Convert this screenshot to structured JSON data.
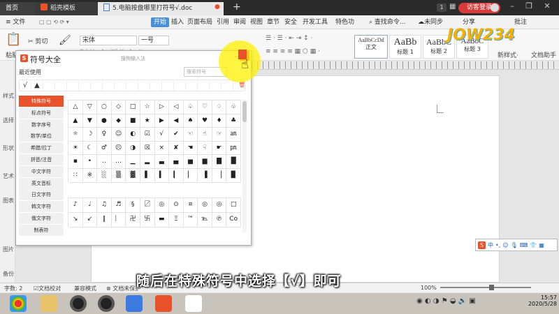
{
  "titlebar": {
    "home_tab": "首页",
    "template_tab": "稻壳模板",
    "doc_tab": "5.电脑按盘哪里打符号√.doc",
    "badge": "1",
    "login": "访客登录"
  },
  "menubar": {
    "file": "≡ 文件",
    "items": [
      "开始",
      "插入",
      "页面布局",
      "引用",
      "审阅",
      "视图",
      "章节",
      "安全",
      "开发工具",
      "特色功"
    ],
    "search": "查找命令...",
    "sync": "未同步",
    "share": "分享",
    "comment": "批注"
  },
  "ribbon": {
    "paste": "粘贴",
    "cut": "剪切",
    "format_painter": "格式刷",
    "font_name": "宋体",
    "font_size": "一号",
    "styles": [
      {
        "sample": "AaBbCcDd",
        "name": "正文"
      },
      {
        "sample": "AaBb",
        "name": "标题 1"
      },
      {
        "sample": "AaBbC",
        "name": "标题 2"
      },
      {
        "sample": "AaBbC",
        "name": "标题 3"
      }
    ],
    "new_style": "新样式·",
    "doc_helper": "文档助手"
  },
  "left_tools": [
    "样式",
    "选择",
    "形状",
    "艺术",
    "图表",
    "图片",
    "备份"
  ],
  "dialog": {
    "logo": "S",
    "title": "符号大全",
    "subtitle": "搜狗输入法",
    "recent_label": "最近使用",
    "search_placeholder": "搜索符号",
    "recent": [
      "√",
      "▲",
      "",
      "",
      "",
      "",
      "",
      "",
      "",
      "",
      "",
      "",
      "",
      "",
      "",
      "",
      "",
      ""
    ],
    "categories": [
      "特殊符号",
      "标点符号",
      "数字序号",
      "数学/单位",
      "希腊/拉丁",
      "拼音/注音",
      "中文字符",
      "英文音标",
      "日文字符",
      "韩文字符",
      "俄文字符",
      "制表符"
    ],
    "active_category": 0,
    "symbols": [
      "△",
      "▽",
      "○",
      "◇",
      "□",
      "☆",
      "▷",
      "◁",
      "♤",
      "♡",
      "♢",
      "♧",
      "▲",
      "▼",
      "●",
      "◆",
      "■",
      "★",
      "▶",
      "◀",
      "♠",
      "♥",
      "♦",
      "♣",
      "☼",
      "☽",
      "♀",
      "☺",
      "◐",
      "☑",
      "√",
      "✔",
      "☜",
      "☝",
      "☞",
      "㏂",
      "☀",
      "☾",
      "♂",
      "☹",
      "◑",
      "☒",
      "×",
      "✘",
      "☚",
      "☟",
      "☛",
      "㏘",
      "▪",
      "•",
      "‥",
      "…",
      "▁",
      "▂",
      "▃",
      "▄",
      "▅",
      "▆",
      "▇",
      "█",
      "∷",
      "※",
      "░",
      "▒",
      "▓",
      "▌",
      "▍",
      "▎",
      "▏",
      "▐",
      "▕",
      "▉"
    ],
    "symbols2": [
      "♪",
      "♩",
      "♫",
      "♬",
      "§",
      "〼",
      "◎",
      "⊙",
      "¤",
      "◎",
      "◎",
      "□",
      "↘",
      "↙",
      "‖",
      "︴",
      "卍",
      "卐",
      "▬",
      "Ξ",
      "™",
      "℡",
      "℗",
      "Co"
    ]
  },
  "statusbar": {
    "word_count": "字数: 2",
    "proofread": "文档校对",
    "compat": "兼容模式",
    "unprotected": "文档未保护",
    "zoom": "100%"
  },
  "caption": "随后在特殊符号中选择【√】即可",
  "watermark": "JOW234",
  "ime": {
    "logo": "S",
    "mode": "中"
  },
  "taskbar": {
    "time": "15:57",
    "date": "2020/5/28"
  },
  "colors": {
    "accent": "#e8512a",
    "primary_tab": "#4a90d9",
    "login": "#d93a3a"
  }
}
